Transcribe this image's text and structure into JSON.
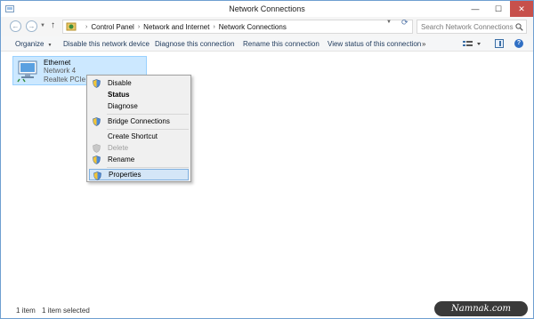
{
  "window": {
    "title": "Network Connections",
    "controls": {
      "minimize": "—",
      "maximize": "☐",
      "close": "✕"
    }
  },
  "address_bar": {
    "breadcrumbs": [
      "Control Panel",
      "Network and Internet",
      "Network Connections"
    ],
    "search_placeholder": "Search Network Connections"
  },
  "toolbar": {
    "organize": "Organize",
    "disable": "Disable this network device",
    "diagnose": "Diagnose this connection",
    "rename": "Rename this connection",
    "status": "View status of this connection",
    "more": "»"
  },
  "connection": {
    "name": "Ethernet",
    "network": "Network  4",
    "adapter": "Realtek PCIe GBE"
  },
  "context_menu": {
    "items": [
      {
        "label": "Disable",
        "icon": "shield-icon"
      },
      {
        "label": "Status",
        "bold": true
      },
      {
        "label": "Diagnose"
      },
      {
        "label": "Bridge Connections",
        "icon": "shield-icon"
      },
      {
        "label": "Create Shortcut"
      },
      {
        "label": "Delete",
        "icon": "shield-icon",
        "disabled": true
      },
      {
        "label": "Rename",
        "icon": "shield-icon"
      },
      {
        "label": "Properties",
        "icon": "shield-icon",
        "highlighted": true
      }
    ]
  },
  "status_bar": {
    "item_count": "1 item",
    "selected": "1 item selected"
  },
  "watermark": "Namnak.com",
  "colors": {
    "accent": "#2f6fc4",
    "selection": "#cce8ff",
    "close_button": "#c7504b"
  }
}
